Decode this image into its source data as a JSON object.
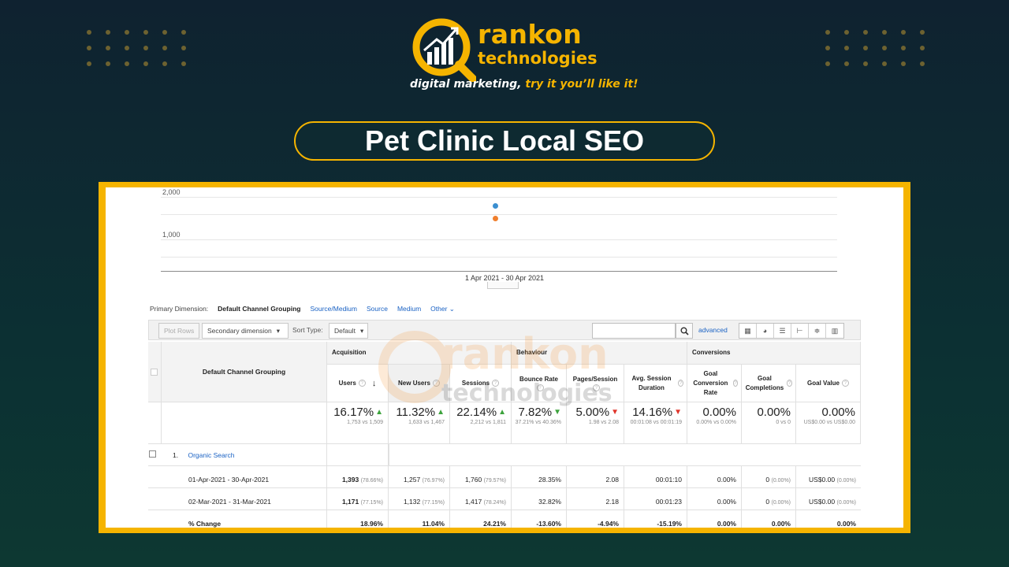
{
  "brand": {
    "name": "rankon",
    "sub": "technologies",
    "tagline_main": "digital marketing, ",
    "tagline_accent": "try it you’ll like it!",
    "accent_color": "#f5b400",
    "icon": "magnifier-growth-chart-icon"
  },
  "slide_title": "Pet Clinic Local SEO",
  "chart": {
    "y_ticks": [
      "2,000",
      "1,000"
    ],
    "date_range": "1 Apr 2021 - 30 Apr 2021",
    "series_colors": [
      "#3b8fd0",
      "#f07f2e"
    ]
  },
  "chart_data": {
    "type": "scatter",
    "x": [
      "1 Apr 2021 - 30 Apr 2021"
    ],
    "series": [
      {
        "name": "",
        "values": [
          1760
        ]
      },
      {
        "name": "",
        "values": [
          1417
        ]
      }
    ],
    "ylim": [
      0,
      2000
    ],
    "grid": true
  },
  "primary_dimension": {
    "label": "Primary Dimension:",
    "active": "Default Channel Grouping",
    "options": [
      "Source/Medium",
      "Source",
      "Medium",
      "Other ⌄"
    ]
  },
  "toolbar": {
    "plot_rows": "Plot Rows",
    "secondary_dimension": "Secondary dimension",
    "sort_type_label": "Sort Type:",
    "sort_type_value": "Default",
    "search_placeholder": "",
    "advanced": "advanced",
    "view_icons": [
      "table-view-icon",
      "pie-view-icon",
      "performance-view-icon",
      "comparison-view-icon",
      "term-cloud-icon",
      "pivot-view-icon"
    ]
  },
  "table": {
    "dimension_header": "Default Channel Grouping",
    "groups": {
      "acquisition": "Acquisition",
      "behaviour": "Behaviour",
      "conversions": "Conversions"
    },
    "columns": [
      "Users",
      "New Users",
      "Sessions",
      "Bounce Rate",
      "Pages/Session",
      "Avg. Session Duration",
      "Goal Conversion Rate",
      "Goal Completions",
      "Goal Value"
    ],
    "summary": [
      {
        "value": "16.17%",
        "detail": "1,753 vs 1,509"
      },
      {
        "value": "11.32%",
        "detail": "1,633 vs 1,467"
      },
      {
        "value": "22.14%",
        "detail": "2,212 vs 1,811"
      },
      {
        "value": "7.82%",
        "detail": "37.21% vs 40.36%"
      },
      {
        "value": "5.00%",
        "detail": "1.98 vs 2.08"
      },
      {
        "value": "14.16%",
        "detail": "00:01:08 vs 00:01:19"
      },
      {
        "value": "0.00%",
        "detail": "0.00% vs 0.00%"
      },
      {
        "value": "0.00%",
        "detail": "0 vs 0"
      },
      {
        "value": "0.00%",
        "detail": "US$0.00 vs US$0.00"
      }
    ],
    "channel_index": "1.",
    "channel_name": "Organic Search",
    "rows": [
      {
        "label": "01-Apr-2021 - 30-Apr-2021",
        "users": "1,393",
        "users_pct": "(78.66%)",
        "new_users": "1,257",
        "new_users_pct": "(76.97%)",
        "sessions": "1,760",
        "sessions_pct": "(79.57%)",
        "bounce": "28.35%",
        "pages": "2.08",
        "duration": "00:01:10",
        "conv_rate": "0.00%",
        "completions": "0",
        "completions_pct": "(0.00%)",
        "goal_value": "US$0.00",
        "goal_value_pct": "(0.00%)"
      },
      {
        "label": "02-Mar-2021 - 31-Mar-2021",
        "users": "1,171",
        "users_pct": "(77.15%)",
        "new_users": "1,132",
        "new_users_pct": "(77.15%)",
        "sessions": "1,417",
        "sessions_pct": "(78.24%)",
        "bounce": "32.82%",
        "pages": "2.18",
        "duration": "00:01:23",
        "conv_rate": "0.00%",
        "completions": "0",
        "completions_pct": "(0.00%)",
        "goal_value": "US$0.00",
        "goal_value_pct": "(0.00%)"
      }
    ],
    "change": {
      "label": "% Change",
      "values": [
        "18.96%",
        "11.04%",
        "24.21%",
        "-13.60%",
        "-4.94%",
        "-15.19%",
        "0.00%",
        "0.00%",
        "0.00%"
      ]
    }
  },
  "watermark": {
    "w1": "rankon",
    "w2": "technologies"
  }
}
